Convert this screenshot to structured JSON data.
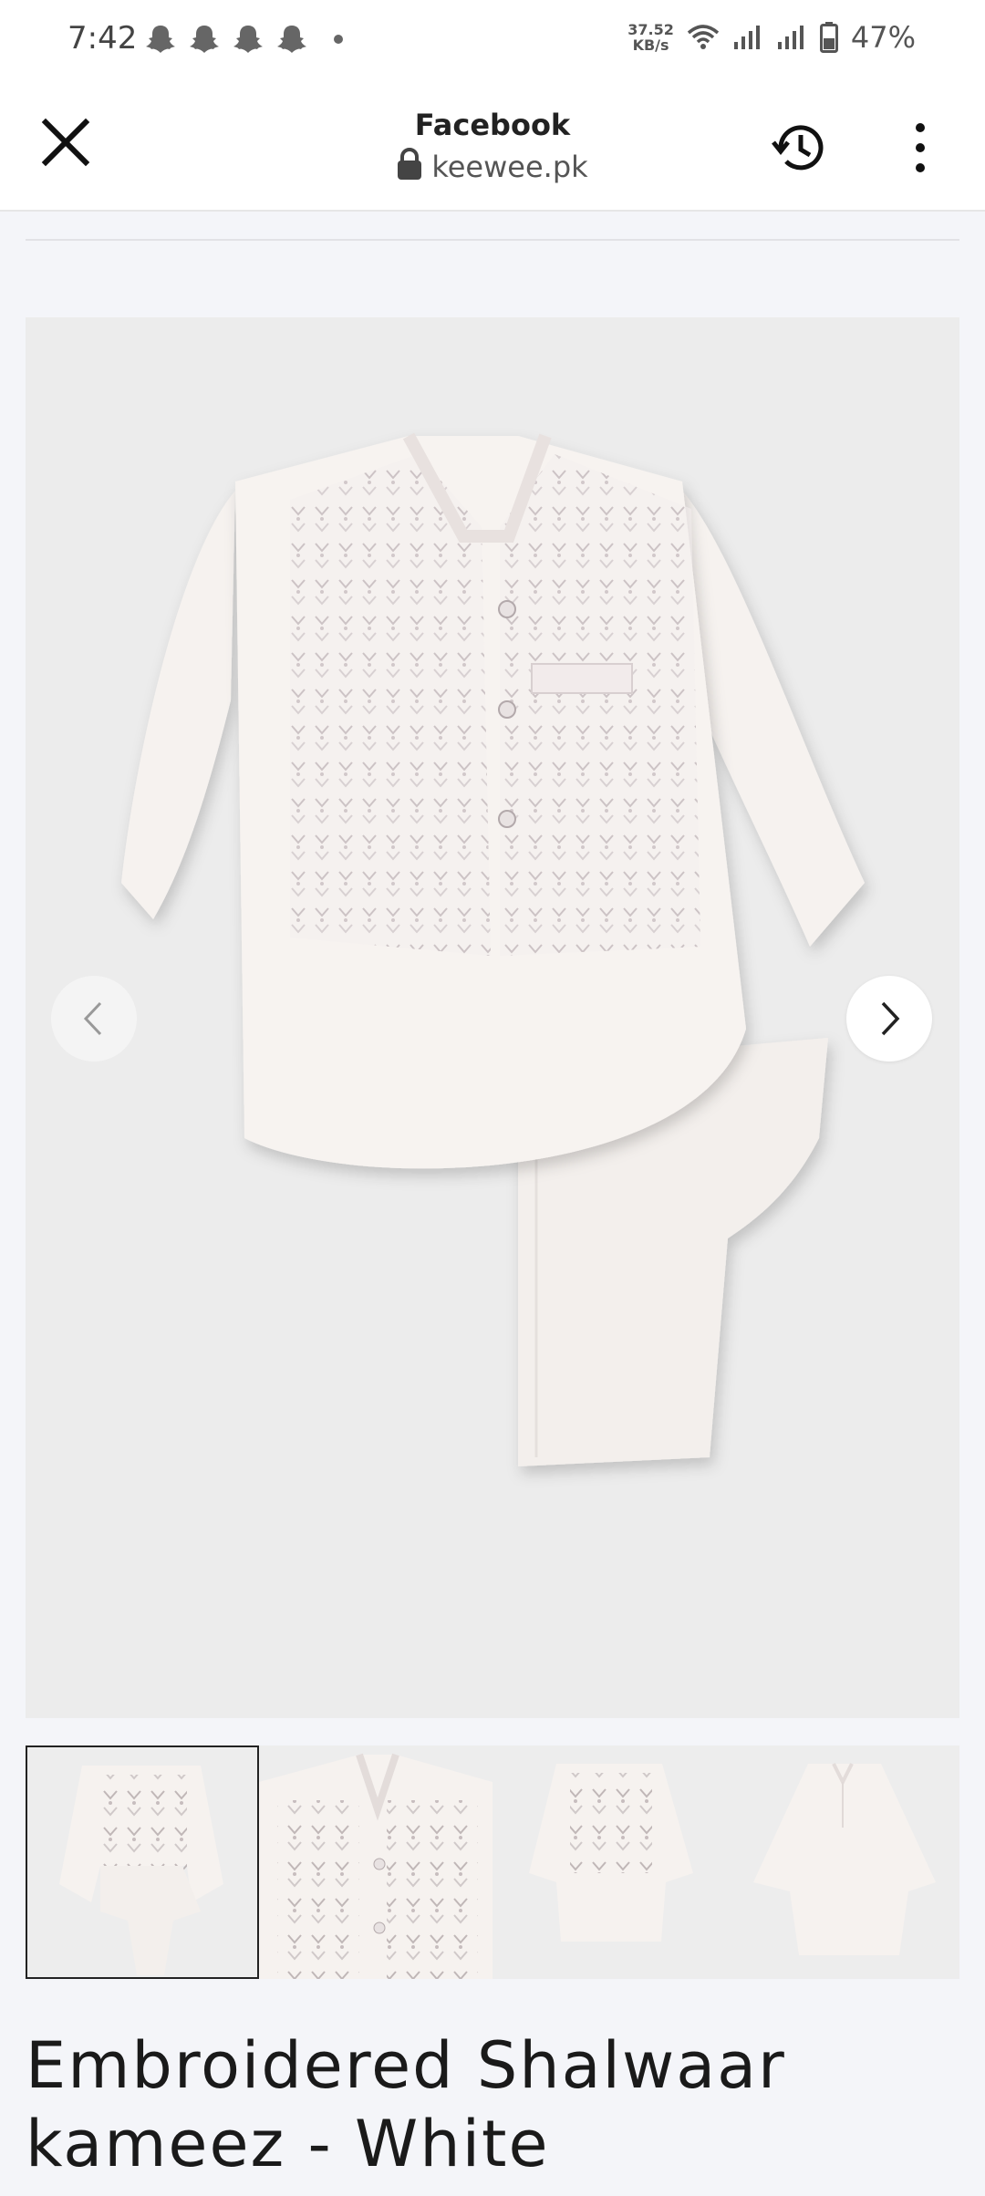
{
  "status_bar": {
    "time": "7:42",
    "net_speed_value": "37.52",
    "net_speed_unit": "KB/s",
    "battery": "47%",
    "notification_icons": [
      "snapchat-icon",
      "snapchat-icon",
      "snapchat-icon",
      "snapchat-icon"
    ]
  },
  "browser": {
    "title": "Facebook",
    "url": "keewee.pk",
    "icons": [
      "close-icon",
      "lock-icon",
      "history-icon",
      "more-vert-icon"
    ]
  },
  "product": {
    "title": "Embroidered Shalwaar kameez - White",
    "gallery_icons": [
      "chevron-left-icon",
      "chevron-right-icon"
    ],
    "thumbnail_count": 4,
    "active_thumbnail": 1
  },
  "colors": {
    "page_background": "#f4f5f9",
    "image_background": "#ececec",
    "garment": "#f6f2ef",
    "embroidery": "#9c8f92"
  }
}
